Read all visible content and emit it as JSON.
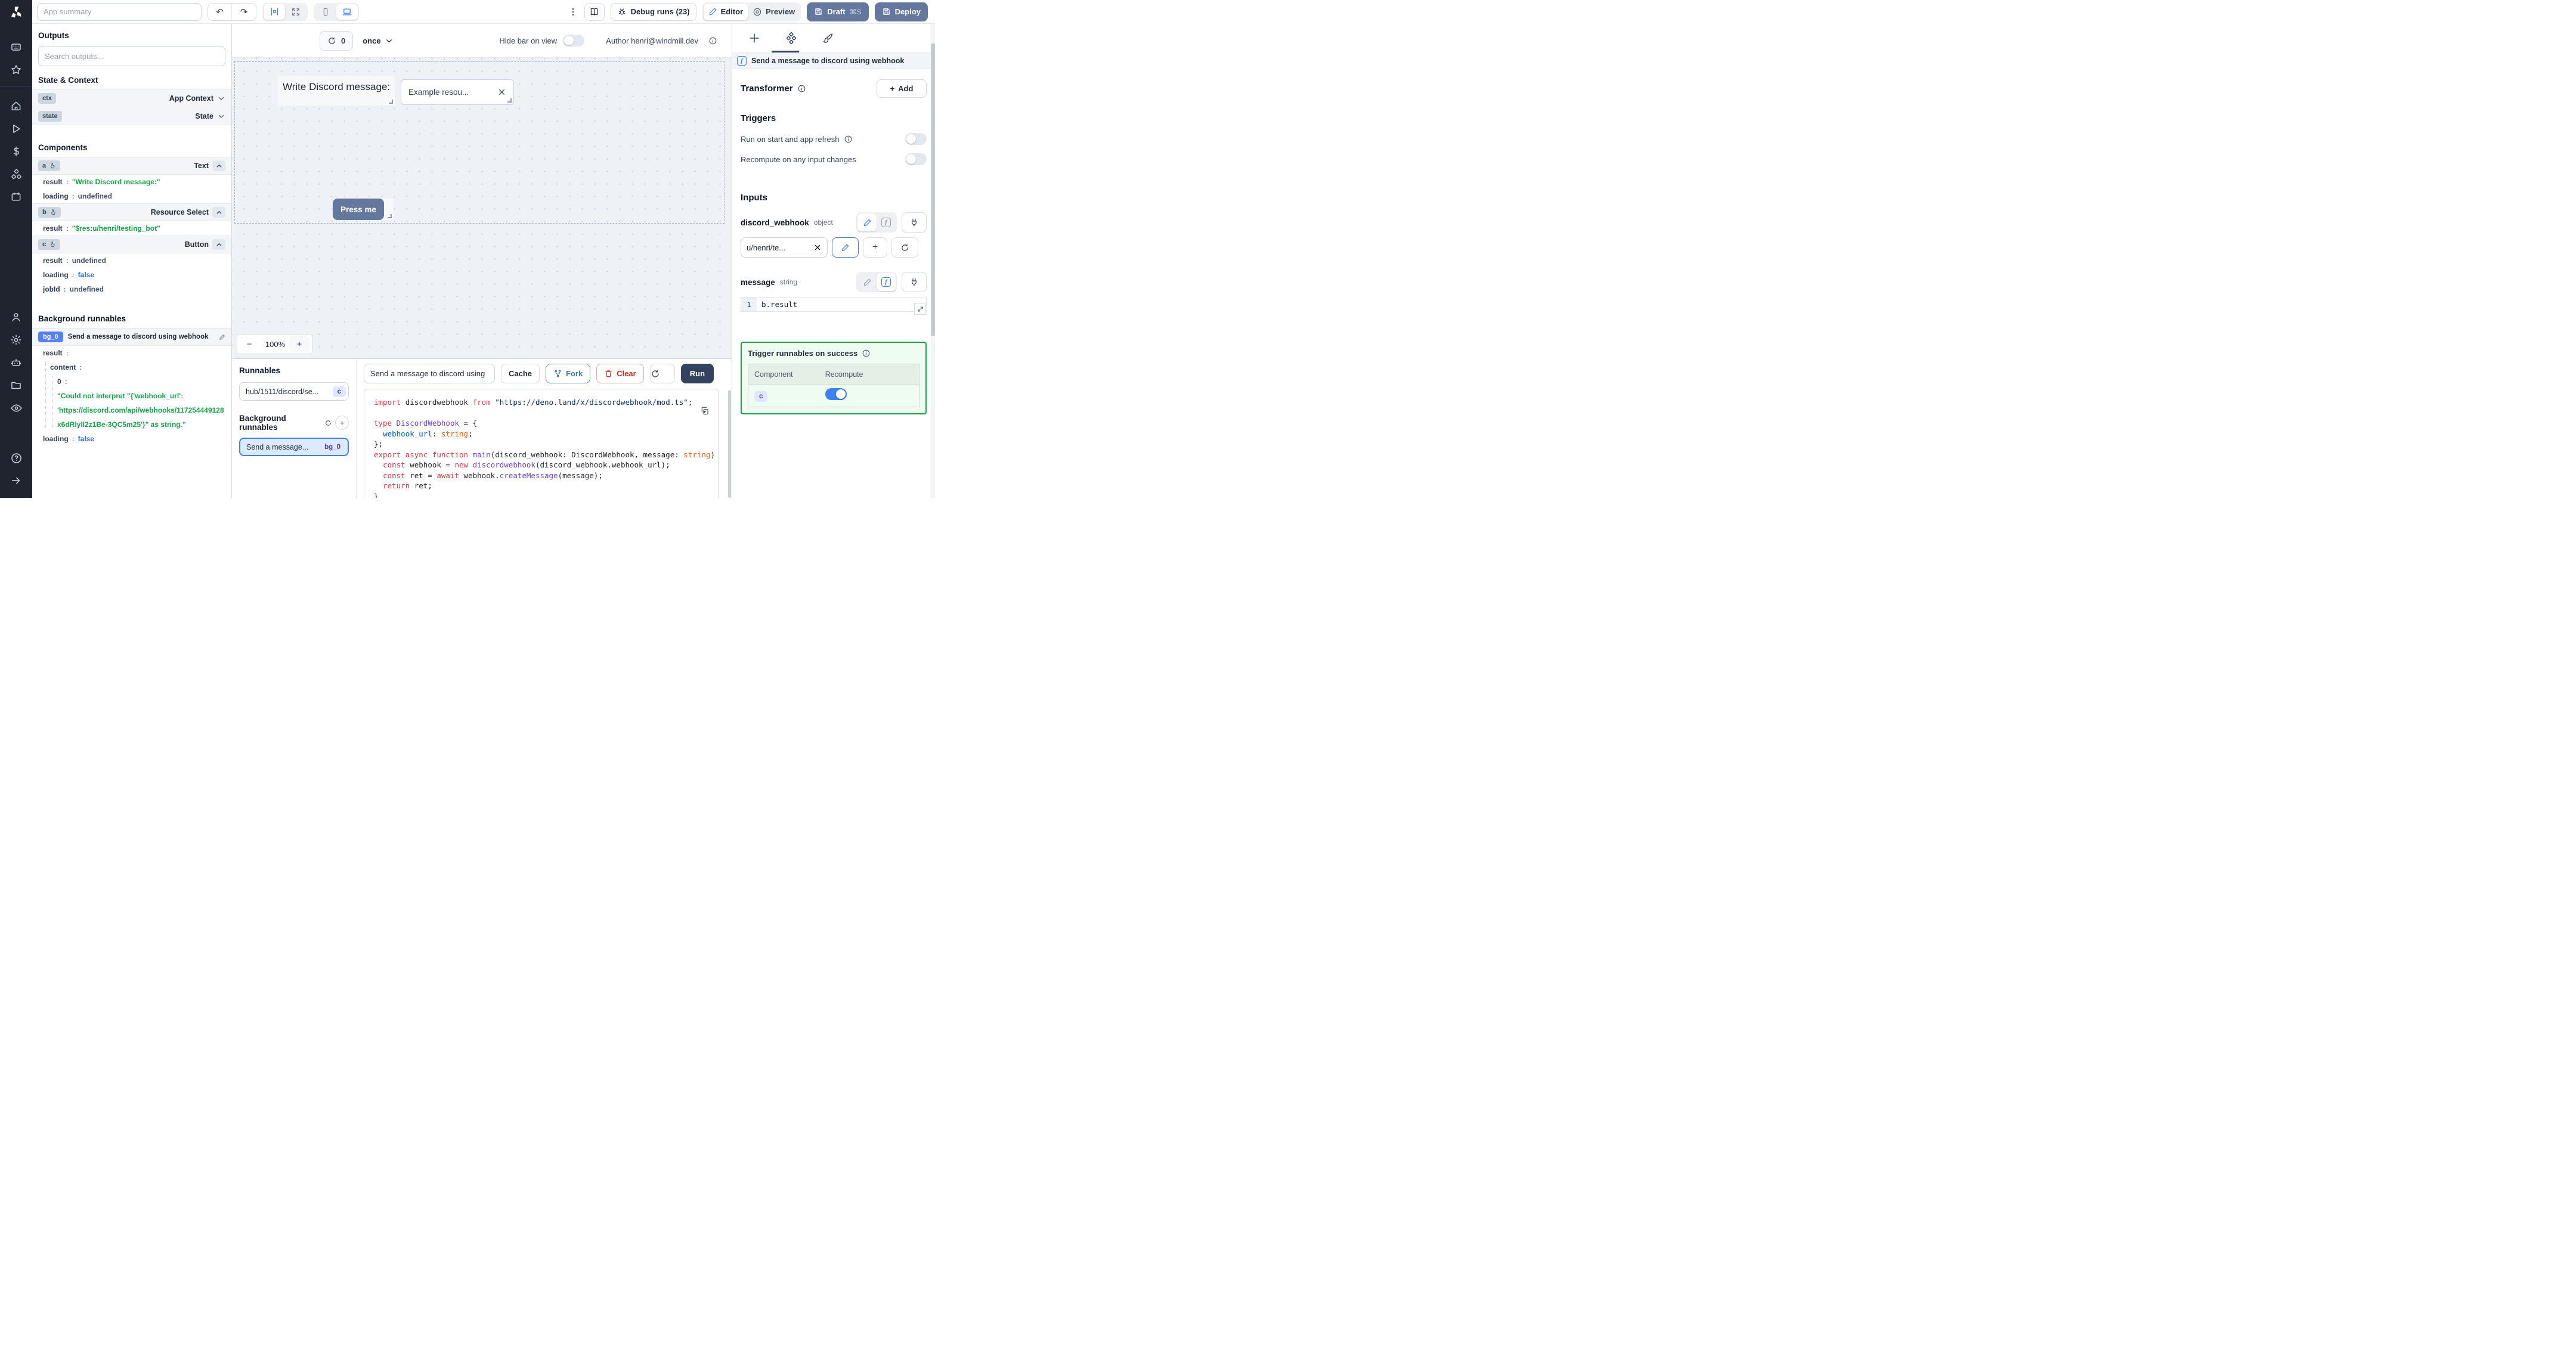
{
  "glyphs": {
    "undo": "↶",
    "redo": "↷",
    "minus": "−",
    "plus": "+",
    "colon": ":",
    "f": "f"
  },
  "topbar": {
    "app_summary_placeholder": "App summary",
    "debug_runs": "Debug runs (23)",
    "editor": "Editor",
    "preview": "Preview",
    "draft": "Draft",
    "draft_shortcut": "⌘S",
    "deploy": "Deploy"
  },
  "outputs": {
    "title": "Outputs",
    "search_placeholder": "Search outputs...",
    "state_context_title": "State & Context",
    "ctx": {
      "badge": "ctx",
      "type": "App Context"
    },
    "state": {
      "badge": "state",
      "type": "State"
    },
    "components_title": "Components",
    "comp_a": {
      "badge": "a",
      "type": "Text"
    },
    "a_rows": [
      {
        "k": "result",
        "v": "\"Write Discord message:\""
      },
      {
        "k": "loading",
        "v": "undefined"
      }
    ],
    "comp_b": {
      "badge": "b",
      "type": "Resource Select"
    },
    "b_rows": [
      {
        "k": "result",
        "v": "\"$res:u/henri/testing_bot\""
      }
    ],
    "comp_c": {
      "badge": "c",
      "type": "Button"
    },
    "c_rows": [
      {
        "k": "result",
        "v": "undefined"
      },
      {
        "k": "loading",
        "v": "false"
      },
      {
        "k": "jobId",
        "v": "undefined"
      }
    ],
    "background_title": "Background runnables",
    "bg0": {
      "badge": "bg_0",
      "name": "Send a message to discord using webhook"
    },
    "bg0_tree": {
      "result_key": "result",
      "content_key": "content",
      "zero_key": "0",
      "error_lines": [
        "\"Could not interpret \"{'webhook_url':",
        "'https://discord.com/api/webhooks/117254449128",
        "x6dRlyll2z1Be-3QC5m25'}\" as string.\""
      ],
      "loading_key": "loading",
      "loading_val": "false"
    }
  },
  "canvas": {
    "refresh_count": "0",
    "schedule": "once",
    "hide_bar": "Hide bar on view",
    "author": "Author henri@windmill.dev",
    "text_component": "Write Discord message:",
    "select_value": "Example resou...",
    "button_label": "Press me",
    "zoom": "100%"
  },
  "runnables": {
    "title": "Runnables",
    "item_label": "hub/1511/discord/se...",
    "item_badge": "c",
    "background_title": "Background runnables",
    "bg_label": "Send a message...",
    "bg_badge": "bg_0"
  },
  "editor": {
    "name": "Send a message to discord using",
    "cache": "Cache",
    "fork": "Fork",
    "clear": "Clear",
    "run": "Run",
    "lines": [
      [
        {
          "c": "k",
          "t": "import "
        },
        {
          "c": "d",
          "t": "discordwebhook "
        },
        {
          "c": "k",
          "t": "from "
        },
        {
          "c": "s",
          "t": "\"https://deno.land/x/discordwebhook/mod.ts\""
        },
        {
          "c": "d",
          "t": ";"
        }
      ],
      [],
      [
        {
          "c": "k",
          "t": "type "
        },
        {
          "c": "p",
          "t": "DiscordWebhook "
        },
        {
          "c": "d",
          "t": "= {"
        }
      ],
      [
        {
          "c": "d",
          "t": "  "
        },
        {
          "c": "b",
          "t": "webhook_url"
        },
        {
          "c": "d",
          "t": ": "
        },
        {
          "c": "o",
          "t": "string"
        },
        {
          "c": "d",
          "t": ";"
        }
      ],
      [
        {
          "c": "d",
          "t": "};"
        }
      ],
      [
        {
          "c": "k",
          "t": "export async function "
        },
        {
          "c": "p",
          "t": "main"
        },
        {
          "c": "d",
          "t": "(discord_webhook: DiscordWebhook, message: "
        },
        {
          "c": "o",
          "t": "string"
        },
        {
          "c": "d",
          "t": ") {"
        }
      ],
      [
        {
          "c": "d",
          "t": "  "
        },
        {
          "c": "k",
          "t": "const "
        },
        {
          "c": "d",
          "t": "webhook = "
        },
        {
          "c": "k",
          "t": "new "
        },
        {
          "c": "p",
          "t": "discordwebhook"
        },
        {
          "c": "d",
          "t": "(discord_webhook.webhook_url);"
        }
      ],
      [
        {
          "c": "d",
          "t": "  "
        },
        {
          "c": "k",
          "t": "const "
        },
        {
          "c": "d",
          "t": "ret = "
        },
        {
          "c": "k",
          "t": "await "
        },
        {
          "c": "d",
          "t": "webhook."
        },
        {
          "c": "p",
          "t": "createMessage"
        },
        {
          "c": "d",
          "t": "(message);"
        }
      ],
      [
        {
          "c": "d",
          "t": "  "
        },
        {
          "c": "k",
          "t": "return "
        },
        {
          "c": "d",
          "t": "ret;"
        }
      ],
      [
        {
          "c": "d",
          "t": "}"
        }
      ]
    ]
  },
  "right": {
    "header": "Send a message to discord using webhook",
    "transformer": "Transformer",
    "add": "Add",
    "triggers": "Triggers",
    "trigger1": "Run on start and app refresh",
    "trigger2": "Recompute on any input changes",
    "inputs_title": "Inputs",
    "dw_name": "discord_webhook",
    "dw_type": "object",
    "dw_value": "u/henri/te...",
    "msg_name": "message",
    "msg_type": "string",
    "msg_lineno": "1",
    "msg_expr": "b.result",
    "success_title": "Trigger runnables on success",
    "col_component": "Component",
    "col_recompute": "Recompute",
    "row_badge": "c"
  },
  "colors": {
    "accent": "#3b82f6",
    "slate_button": "#64789e",
    "run_button": "#33425f",
    "success_green": "#16a34a"
  }
}
